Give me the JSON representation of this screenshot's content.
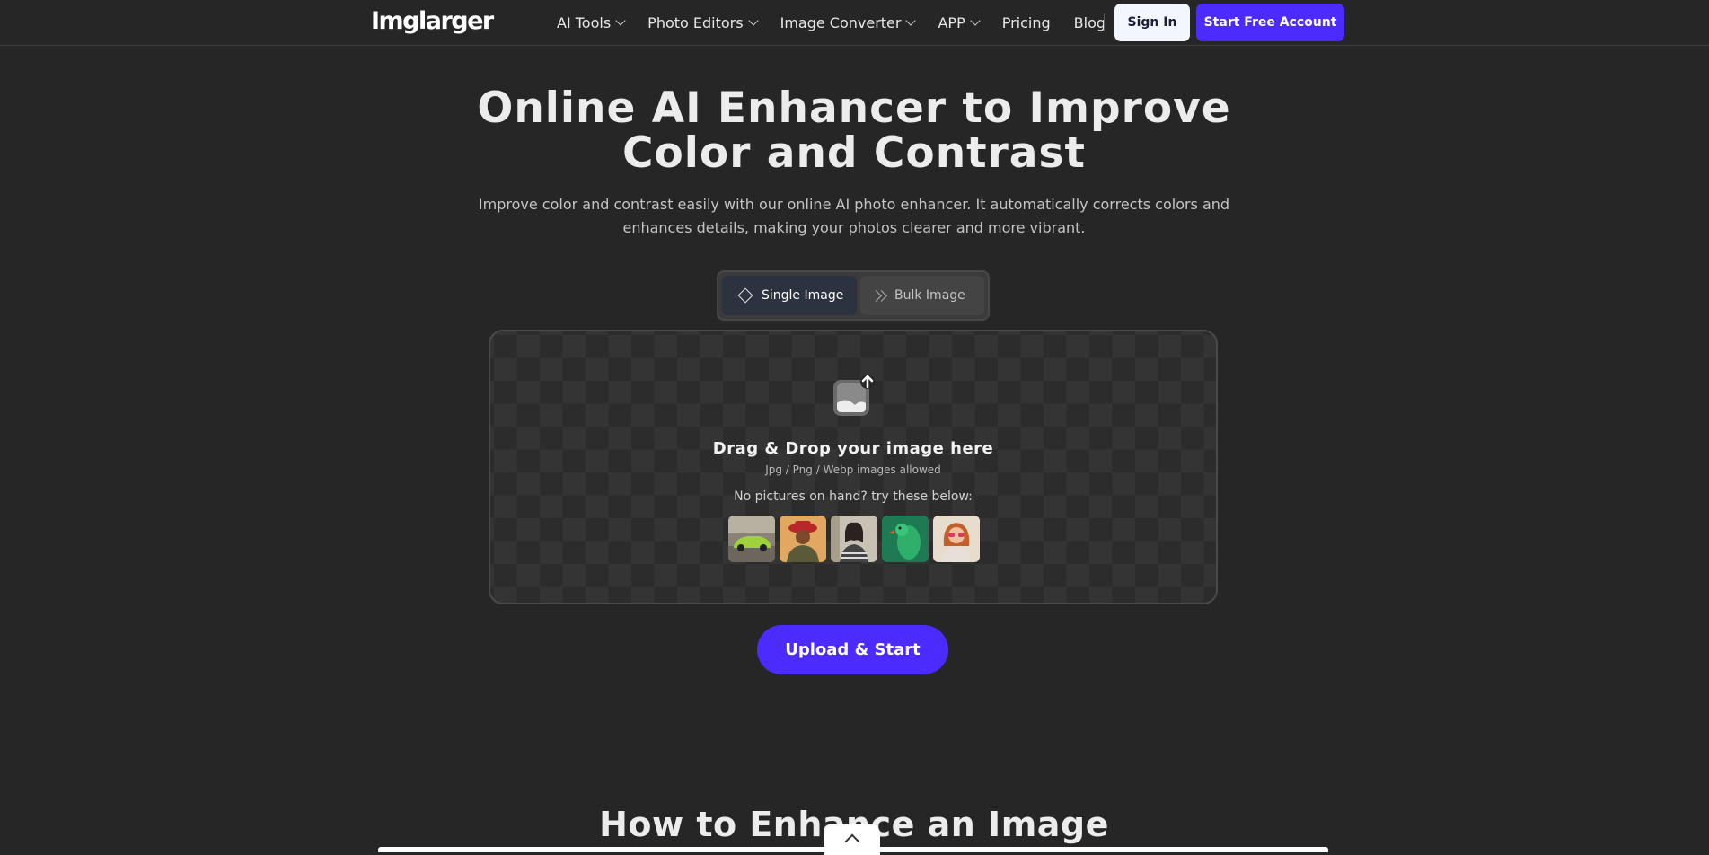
{
  "nav": {
    "logo": "Imglarger",
    "items": [
      {
        "label": "AI Tools",
        "dropdown": true
      },
      {
        "label": "Photo Editors",
        "dropdown": true
      },
      {
        "label": "Image Converter",
        "dropdown": true
      },
      {
        "label": "APP",
        "dropdown": true
      },
      {
        "label": "Pricing",
        "dropdown": false
      },
      {
        "label": "Blog",
        "dropdown": false
      }
    ],
    "sign_in": "Sign In",
    "start_free": "Start Free Account"
  },
  "hero": {
    "title_line1": "Online AI Enhancer to Improve",
    "title_line2": "Color and Contrast",
    "subtitle_line1": "Improve color and contrast easily with our online AI photo enhancer. It automatically corrects colors and",
    "subtitle_line2": "enhances details, making your photos clearer and more vibrant."
  },
  "mode_toggle": {
    "single": "Single Image",
    "bulk": "Bulk Image",
    "selected": "Single Image"
  },
  "dropzone": {
    "title": "Drag & Drop your image here",
    "formats": "Jpg / Png / Webp images allowed",
    "try_text": "No pictures on hand? try these below:",
    "sample_icons": [
      "sample-car",
      "sample-man-hat",
      "sample-woman-striped",
      "sample-parrot",
      "sample-woman-sunglasses"
    ]
  },
  "cta": {
    "upload": "Upload & Start"
  },
  "section": {
    "title": "How to Enhance an Image"
  },
  "colors": {
    "background": "#262626",
    "accent": "#4b2bff",
    "text": "#ececec"
  }
}
